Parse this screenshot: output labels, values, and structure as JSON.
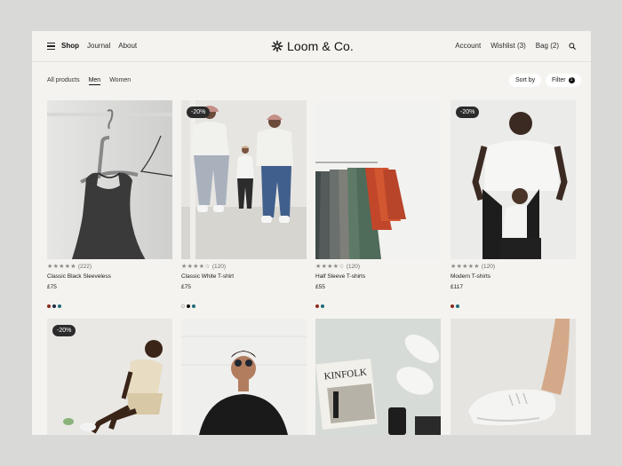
{
  "header": {
    "nav": [
      {
        "label": "Shop",
        "active": true
      },
      {
        "label": "Journal",
        "active": false
      },
      {
        "label": "About",
        "active": false
      }
    ],
    "logo": "Loom & Co.",
    "account": "Account",
    "wishlist": "Wishlist (3)",
    "bag": "Bag (2)"
  },
  "toolbar": {
    "categories": [
      {
        "label": "All products",
        "active": false
      },
      {
        "label": "Men",
        "active": true
      },
      {
        "label": "Women",
        "active": false
      }
    ],
    "sort_label": "Sort by",
    "filter_label": "Filter",
    "filter_count": "1"
  },
  "products": [
    {
      "name": "Classic Black Sleeveless",
      "price": "£75",
      "reviews": "(222)",
      "rating": 5,
      "badge": "",
      "swatches": [
        "#8b2a1e",
        "#1e2a3a",
        "#1f6b7a"
      ],
      "image": "black-sleeveless-on-hanger"
    },
    {
      "name": "Classic White T-shirt",
      "price": "£75",
      "reviews": "(120)",
      "rating": 4,
      "badge": "-20%",
      "swatches": [
        "#ffffff",
        "#111111",
        "#1f6b7a"
      ],
      "image": "two-men-white-tshirts"
    },
    {
      "name": "Half Sleeve T-shirts",
      "price": "£55",
      "reviews": "(120)",
      "rating": 4,
      "badge": "",
      "swatches": [
        "#8b2a1e",
        "#1f6b7a"
      ],
      "image": "tshirts-on-rack"
    },
    {
      "name": "Modern T-shirts",
      "price": "£117",
      "reviews": "(120)",
      "rating": 5,
      "badge": "-20%",
      "swatches": [
        "#8b2a1e",
        "#1f6b7a"
      ],
      "image": "father-and-child"
    },
    {
      "name": "",
      "price": "",
      "reviews": "",
      "rating": 0,
      "badge": "-20%",
      "swatches": [],
      "image": "man-sitting-beige-outfit"
    },
    {
      "name": "",
      "price": "",
      "reviews": "",
      "rating": 0,
      "badge": "",
      "swatches": [],
      "image": "man-sunglasses-black-tee"
    },
    {
      "name": "",
      "price": "",
      "reviews": "",
      "rating": 0,
      "badge": "",
      "swatches": [],
      "image": "flatlay-sneakers-magazine"
    },
    {
      "name": "",
      "price": "",
      "reviews": "",
      "rating": 0,
      "badge": "",
      "swatches": [],
      "image": "white-sneaker-foot"
    }
  ],
  "image_text": {
    "magazine_title": "KINFOLK"
  },
  "icons": [
    "menu-icon",
    "logo-icon",
    "search-icon",
    "star-icon"
  ]
}
